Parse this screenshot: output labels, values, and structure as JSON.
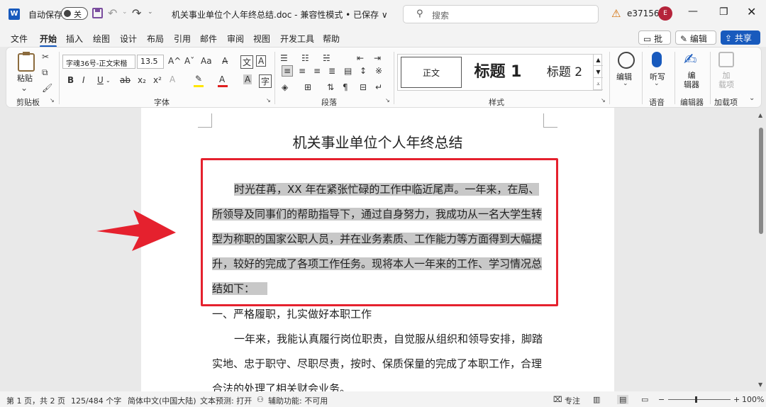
{
  "titlebar": {
    "autosave_label": "自动保存",
    "autosave_state": "关",
    "doc_title": "机关事业单位个人年终总结.doc  -  兼容性模式 • 已保存 ∨",
    "search_placeholder": "搜索",
    "username": "e37156",
    "avatar_initial": "E"
  },
  "tabs": [
    "文件",
    "开始",
    "插入",
    "绘图",
    "设计",
    "布局",
    "引用",
    "邮件",
    "审阅",
    "视图",
    "开发工具",
    "帮助"
  ],
  "active_tab": "开始",
  "top_buttons": {
    "comment": "批注",
    "edit": "编辑",
    "share": "共享"
  },
  "ribbon": {
    "clipboard": {
      "paste": "粘贴",
      "label": "剪贴板"
    },
    "font": {
      "font_name": "字魂36号-正文宋楷",
      "font_size": "13.5",
      "label": "字体",
      "bold": "B",
      "italic": "I",
      "underline": "U",
      "strike": "ab",
      "subscript": "x₂",
      "superscript": "x²",
      "grow": "A^",
      "shrink": "Aˇ",
      "case": "Aa"
    },
    "paragraph": {
      "label": "段落"
    },
    "styles": {
      "normal": "正文",
      "heading1": "标题 1",
      "heading2": "标题 2",
      "label": "样式"
    },
    "editing": {
      "label": "编辑"
    },
    "voice": {
      "dictate": "听写",
      "label": "语音"
    },
    "editor": {
      "button": "编\n辑器",
      "label": "编辑器"
    },
    "addins": {
      "button": "加\n载项",
      "label": "加载项"
    }
  },
  "document": {
    "heading": "机关事业单位个人年终总结",
    "highlighted_lines": [
      "时光荏苒，XX 年在紧张忙碌的工作中临近尾声。一年来，在局、",
      "所领导及同事们的帮助指导下，通过自身努力，我成功从一名大学生转",
      "型为称职的国家公职人员，并在业务素质、工作能力等方面得到大幅提",
      "升，较好的完成了各项工作任务。现将本人一年来的工作、学习情况总",
      "结如下："
    ],
    "section1": "一、严格履职，扎实做好本职工作",
    "body_lines": [
      "一年来，我能认真履行岗位职责，自觉服从组织和领导安排，脚踏",
      "实地、忠于职守、尽职尽责，按时、保质保量的完成了本职工作，合理",
      "合法的处理了相关财会业务。"
    ]
  },
  "statusbar": {
    "page": "第 1 页，共 2 页",
    "words": "125/484 个字",
    "language": "简体中文(中国大陆)",
    "predict": "文本预测: 打开",
    "accessibility": "辅助功能: 不可用",
    "focus": "专注",
    "zoom": "100%"
  },
  "colors": {
    "accent": "#185abd",
    "annotation_red": "#e5212e",
    "highlight": "#c8c8c8"
  }
}
